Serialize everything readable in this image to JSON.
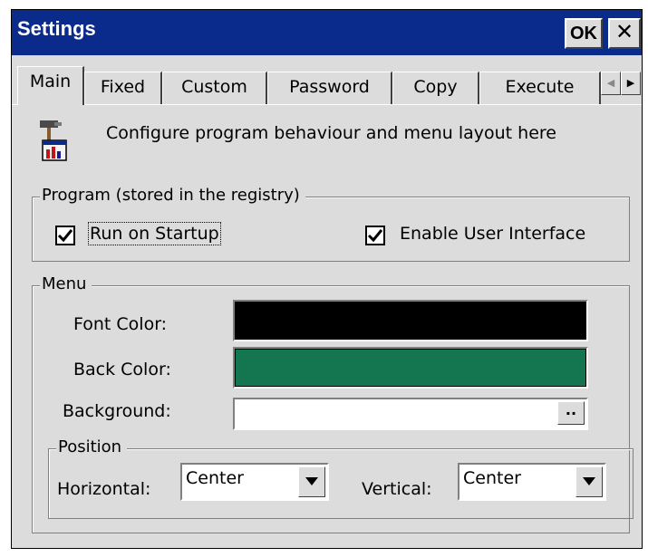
{
  "window": {
    "title": "Settings",
    "ok_label": "OK",
    "close_label": "✕"
  },
  "tabs": [
    {
      "label": "Main",
      "active": true
    },
    {
      "label": "Fixed"
    },
    {
      "label": "Custom"
    },
    {
      "label": "Password"
    },
    {
      "label": "Copy"
    },
    {
      "label": "Execute"
    }
  ],
  "tab_scroll": {
    "left_icon": "arrow-left-icon",
    "right_icon": "arrow-right-icon"
  },
  "header": {
    "icon": "settings-tools-icon",
    "text": "Configure program behaviour and menu layout here"
  },
  "program_group": {
    "legend": "Program (stored in the registry)",
    "run_on_startup": {
      "label": "Run on Startup",
      "checked": true
    },
    "enable_ui": {
      "label": "Enable User Interface",
      "checked": true
    }
  },
  "menu_group": {
    "legend": "Menu",
    "font_color": {
      "label": "Font Color:",
      "value": "#000000"
    },
    "back_color": {
      "label": "Back Color:",
      "value": "#137650"
    },
    "background": {
      "label": "Background:",
      "value": "",
      "browse_label": ".."
    },
    "position": {
      "legend": "Position",
      "horizontal": {
        "label": "Horizontal:",
        "value": "Center"
      },
      "vertical": {
        "label": "Vertical:",
        "value": "Center"
      }
    }
  },
  "colors": {
    "titlebar": "#0a2b8c",
    "dialog": "#dcdcdc"
  }
}
